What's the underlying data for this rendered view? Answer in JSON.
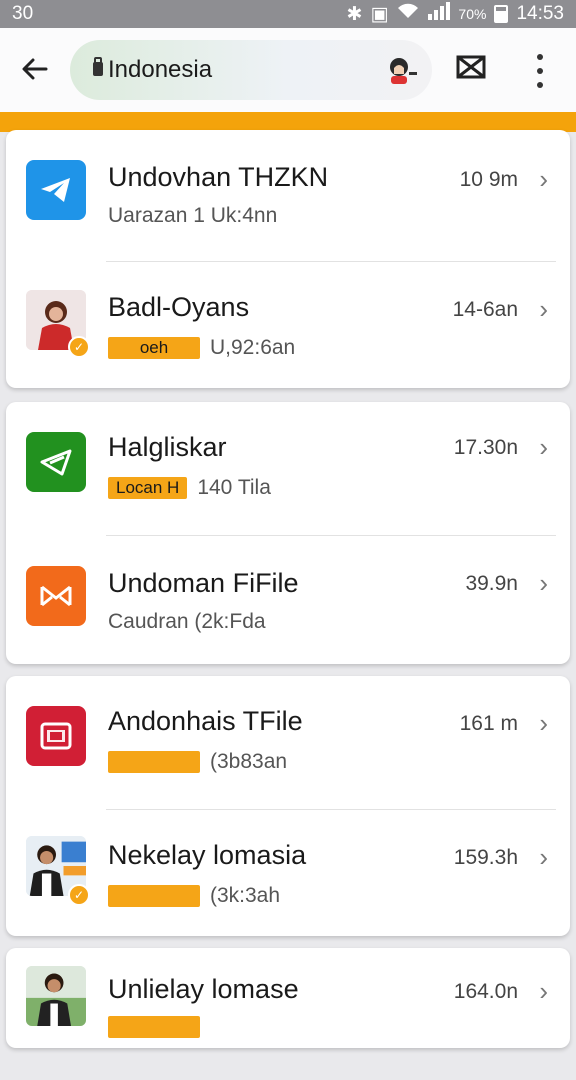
{
  "status_bar": {
    "left": "30",
    "battery": "70%",
    "time": "14:53"
  },
  "app_bar": {
    "search_text": "Indonesia",
    "back_icon": "arrow-left-icon",
    "search_icon": "bag-icon",
    "action_icons": [
      "avatar-icon",
      "mail-icon",
      "more-vert-icon"
    ]
  },
  "accent_color": "#f4a30b",
  "items": [
    {
      "title": "Undovhan THZKN",
      "subtitle": "Uarazan 1 Uk:4nn",
      "tag": "",
      "time": "10 9m",
      "icon": "telegram-blue-icon"
    },
    {
      "title": "Badl-Oyans",
      "subtitle": "U,92:6an",
      "tag": "oeh",
      "time": "14-6an",
      "icon": "person-photo-avatar"
    },
    {
      "title": "Halgliskar",
      "subtitle": "140 Tila",
      "tag": "Locan H",
      "time": "17.30n",
      "icon": "telegram-green-icon"
    },
    {
      "title": "Undoman FiFile",
      "subtitle": "Caudran  (2k:Fda",
      "tag": "",
      "time": "39.9n",
      "icon": "xiaomi-orange-icon"
    },
    {
      "title": "Andonhais TFile",
      "subtitle": "(3b83an",
      "tag": "",
      "time": "161 m",
      "icon": "red-app-icon"
    },
    {
      "title": "Nekelay lomasia",
      "subtitle": "(3k:3ah",
      "tag": "",
      "time": "159.3h",
      "icon": "person-photo-avatar"
    },
    {
      "title": "Unlielay lomase",
      "subtitle": "",
      "tag": "",
      "time": "164.0n",
      "icon": "person-photo-avatar"
    }
  ]
}
